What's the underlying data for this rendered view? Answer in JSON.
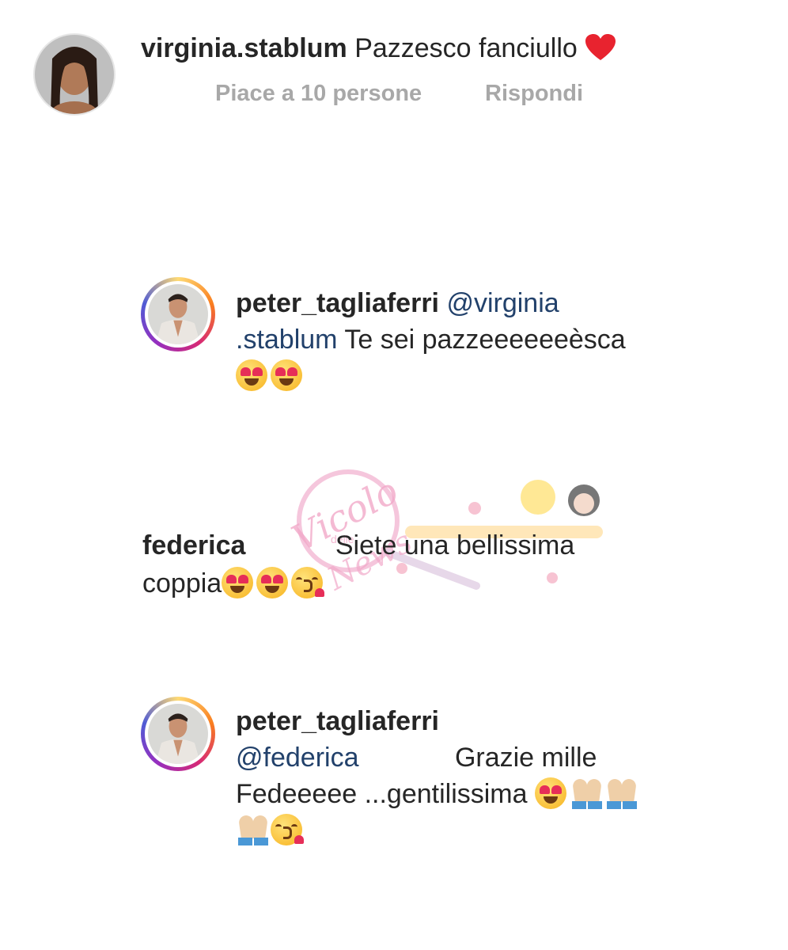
{
  "comments": [
    {
      "username": "virginia.stablum",
      "text": "Pazzesco fanciullo",
      "likes_label": "Piace a 10 persone",
      "reply_label": "Rispondi"
    },
    {
      "username": "peter_tagliaferri",
      "mention_part1": "@virginia",
      "mention_part2": ".stablum",
      "text": "Te sei pazzeeeeeeèsca"
    },
    {
      "username": "federica",
      "text_part1": "Siete una bellissima",
      "text_part2": "coppia"
    },
    {
      "username": "peter_tagliaferri",
      "mention": "@federica",
      "text_part1": "Grazie mille",
      "text_part2": "Fedeeeee ...gentilissima"
    }
  ],
  "watermark": {
    "brand_text": "Vicolo delle News"
  }
}
